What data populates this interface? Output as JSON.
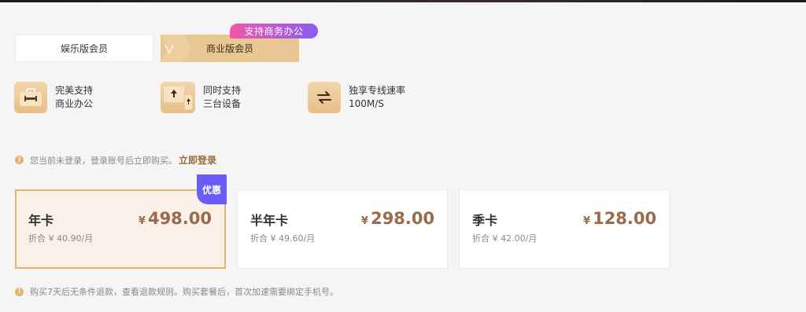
{
  "tabs": {
    "entertainment_label": "娱乐版会员",
    "business_label": "商业版会员",
    "promo_badge": "支持商务办公"
  },
  "features": [
    {
      "icon": "briefcase-icon",
      "line1": "完美支持",
      "line2": "商业办公"
    },
    {
      "icon": "devices-icon",
      "line1": "同时支持",
      "line2": "三台设备"
    },
    {
      "icon": "swap-arrows-icon",
      "line1": "独享专线速率",
      "line2": "100M/S"
    }
  ],
  "notice": {
    "text": "您当前未登录，登录账号后立即购买。",
    "login_link": "立即登录"
  },
  "discount_badge": "优惠",
  "plans": [
    {
      "name": "年卡",
      "currency": "¥",
      "price": "498.00",
      "monthly": "折合 ¥ 40.90/月"
    },
    {
      "name": "半年卡",
      "currency": "¥",
      "price": "298.00",
      "monthly": "折合 ¥ 49.60/月"
    },
    {
      "name": "季卡",
      "currency": "¥",
      "price": "128.00",
      "monthly": "折合 ¥ 42.00/月"
    }
  ],
  "footer_note": "购买7天后无条件退款，查看退款规则。购买套餐后，首次加速需要绑定手机号。",
  "colors": {
    "accent_gold": "#e9c792",
    "price_brown": "#9a6a4a",
    "badge_purple": "#6a5cf6",
    "promo_pink": "#f057a9"
  }
}
